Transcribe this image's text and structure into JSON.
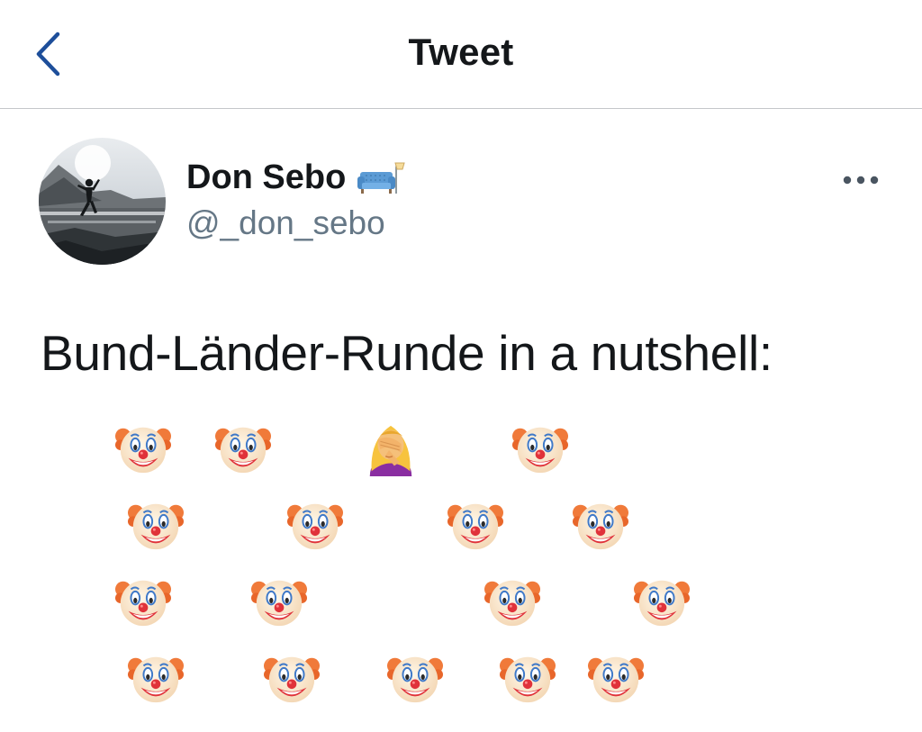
{
  "header": {
    "title": "Tweet"
  },
  "tweet": {
    "author": {
      "name": "Don Sebo",
      "handle": "@_don_sebo"
    },
    "text": "Bund-Länder-Runde in a nutshell:",
    "emoji_rows": [
      [
        "clown-face",
        "clown-face",
        "facepalm",
        "clown-face"
      ],
      [
        "clown-face",
        "clown-face",
        "clown-face",
        "clown-face"
      ],
      [
        "clown-face",
        "clown-face",
        "clown-face",
        "clown-face"
      ],
      [
        "clown-face",
        "clown-face",
        "clown-face",
        "clown-face",
        "clown-face"
      ]
    ]
  },
  "colors": {
    "accent": "#1d4e9a",
    "text": "#14171a",
    "secondary": "#657786"
  },
  "icons": {
    "back": "chevron-left-icon",
    "more": "more-dots-icon",
    "name_emoji": "couch-and-lamp-icon"
  }
}
